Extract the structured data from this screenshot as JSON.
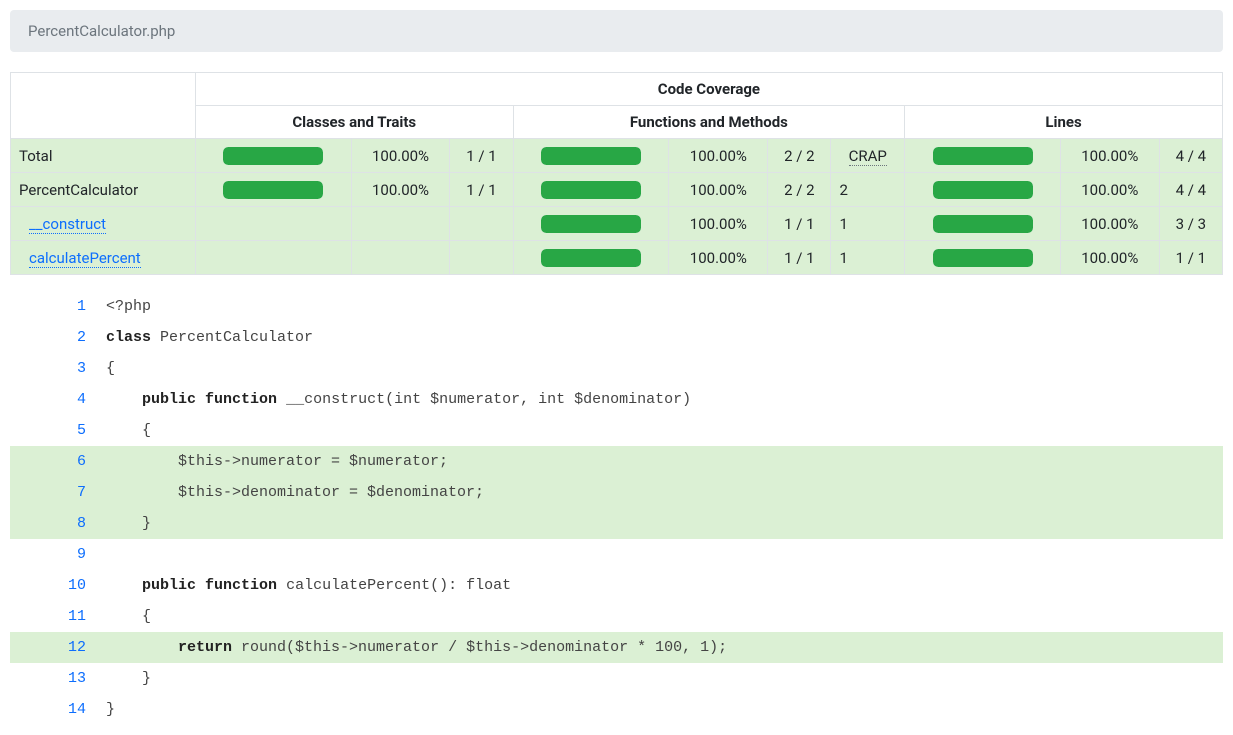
{
  "breadcrumb": "PercentCalculator.php",
  "headers": {
    "codeCoverage": "Code Coverage",
    "classes": "Classes and Traits",
    "functions": "Functions and Methods",
    "lines": "Lines"
  },
  "crapLabel": "CRAP",
  "rows": [
    {
      "name": "Total",
      "link": false,
      "indent": 0,
      "classes": {
        "pct": "100.00%",
        "ratio": "1 / 1",
        "barPct": 100
      },
      "functions": {
        "pct": "100.00%",
        "ratio": "2 / 2",
        "crap": null,
        "barPct": 100
      },
      "lines": {
        "pct": "100.00%",
        "ratio": "4 / 4",
        "barPct": 100
      },
      "showClasses": true,
      "showCrapLabel": true
    },
    {
      "name": "PercentCalculator",
      "link": false,
      "indent": 0,
      "classes": {
        "pct": "100.00%",
        "ratio": "1 / 1",
        "barPct": 100
      },
      "functions": {
        "pct": "100.00%",
        "ratio": "2 / 2",
        "crap": "2",
        "barPct": 100
      },
      "lines": {
        "pct": "100.00%",
        "ratio": "4 / 4",
        "barPct": 100
      },
      "showClasses": true,
      "showCrapLabel": false
    },
    {
      "name": "__construct",
      "link": true,
      "indent": 1,
      "classes": null,
      "functions": {
        "pct": "100.00%",
        "ratio": "1 / 1",
        "crap": "1",
        "barPct": 100
      },
      "lines": {
        "pct": "100.00%",
        "ratio": "3 / 3",
        "barPct": 100
      },
      "showClasses": false,
      "showCrapLabel": false
    },
    {
      "name": "calculatePercent",
      "link": true,
      "indent": 1,
      "classes": null,
      "functions": {
        "pct": "100.00%",
        "ratio": "1 / 1",
        "crap": "1",
        "barPct": 100
      },
      "lines": {
        "pct": "100.00%",
        "ratio": "1 / 1",
        "barPct": 100
      },
      "showClasses": false,
      "showCrapLabel": false
    }
  ],
  "source": [
    {
      "n": 1,
      "covered": false,
      "tokens": [
        {
          "t": "default",
          "v": "<?php"
        }
      ]
    },
    {
      "n": 2,
      "covered": false,
      "tokens": [
        {
          "t": "keyword",
          "v": "class"
        },
        {
          "t": "default",
          "v": " PercentCalculator"
        }
      ]
    },
    {
      "n": 3,
      "covered": false,
      "tokens": [
        {
          "t": "default",
          "v": "{"
        }
      ]
    },
    {
      "n": 4,
      "covered": false,
      "tokens": [
        {
          "t": "default",
          "v": "    "
        },
        {
          "t": "keyword",
          "v": "public"
        },
        {
          "t": "default",
          "v": " "
        },
        {
          "t": "keyword",
          "v": "function"
        },
        {
          "t": "default",
          "v": " __construct(int $numerator, int $denominator)"
        }
      ]
    },
    {
      "n": 5,
      "covered": false,
      "tokens": [
        {
          "t": "default",
          "v": "    {"
        }
      ]
    },
    {
      "n": 6,
      "covered": true,
      "tokens": [
        {
          "t": "default",
          "v": "        $this->numerator = $numerator;"
        }
      ]
    },
    {
      "n": 7,
      "covered": true,
      "tokens": [
        {
          "t": "default",
          "v": "        $this->denominator = $denominator;"
        }
      ]
    },
    {
      "n": 8,
      "covered": true,
      "tokens": [
        {
          "t": "default",
          "v": "    }"
        }
      ]
    },
    {
      "n": 9,
      "covered": false,
      "tokens": [
        {
          "t": "default",
          "v": ""
        }
      ]
    },
    {
      "n": 10,
      "covered": false,
      "tokens": [
        {
          "t": "default",
          "v": "    "
        },
        {
          "t": "keyword",
          "v": "public"
        },
        {
          "t": "default",
          "v": " "
        },
        {
          "t": "keyword",
          "v": "function"
        },
        {
          "t": "default",
          "v": " calculatePercent(): float"
        }
      ]
    },
    {
      "n": 11,
      "covered": false,
      "tokens": [
        {
          "t": "default",
          "v": "    {"
        }
      ]
    },
    {
      "n": 12,
      "covered": true,
      "tokens": [
        {
          "t": "default",
          "v": "        "
        },
        {
          "t": "keyword",
          "v": "return"
        },
        {
          "t": "default",
          "v": " round($this->numerator / $this->denominator * 100, 1);"
        }
      ]
    },
    {
      "n": 13,
      "covered": false,
      "tokens": [
        {
          "t": "default",
          "v": "    }"
        }
      ]
    },
    {
      "n": 14,
      "covered": false,
      "tokens": [
        {
          "t": "default",
          "v": "}"
        }
      ]
    }
  ]
}
